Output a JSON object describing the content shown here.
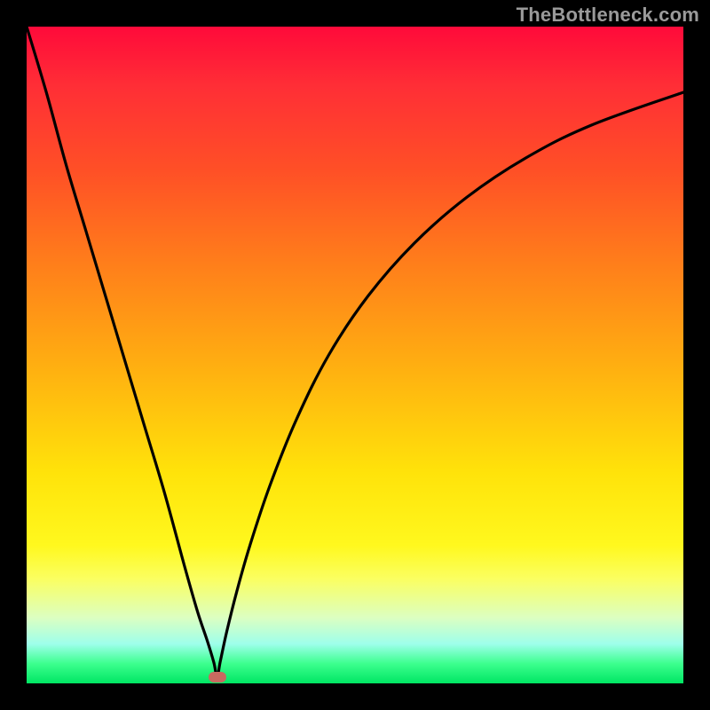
{
  "watermark": "TheBottleneck.com",
  "colors": {
    "frame": "#000000",
    "curve": "#000000",
    "minpoint": "#c86a60",
    "gradient_top": "#ff0a3a",
    "gradient_bottom": "#00e663"
  },
  "chart_data": {
    "type": "line",
    "title": "",
    "xlabel": "",
    "ylabel": "",
    "xlim": [
      0,
      100
    ],
    "ylim": [
      0,
      100
    ],
    "grid": false,
    "legend": false,
    "min_point": {
      "x": 29,
      "y": 1
    },
    "series": [
      {
        "name": "bottleneck-curve",
        "x": [
          0,
          3,
          6,
          9,
          12,
          15,
          18,
          21,
          24,
          26,
          27.5,
          28.5,
          29,
          29.5,
          30.5,
          32,
          34,
          37,
          41,
          46,
          52,
          59,
          67,
          76,
          86,
          100
        ],
        "y": [
          100,
          90,
          79,
          69,
          59,
          49,
          39,
          29,
          18,
          11,
          6.5,
          3.2,
          1,
          3.4,
          8,
          14,
          21,
          30,
          40,
          50,
          59,
          67,
          74,
          80,
          85,
          90
        ]
      }
    ]
  }
}
